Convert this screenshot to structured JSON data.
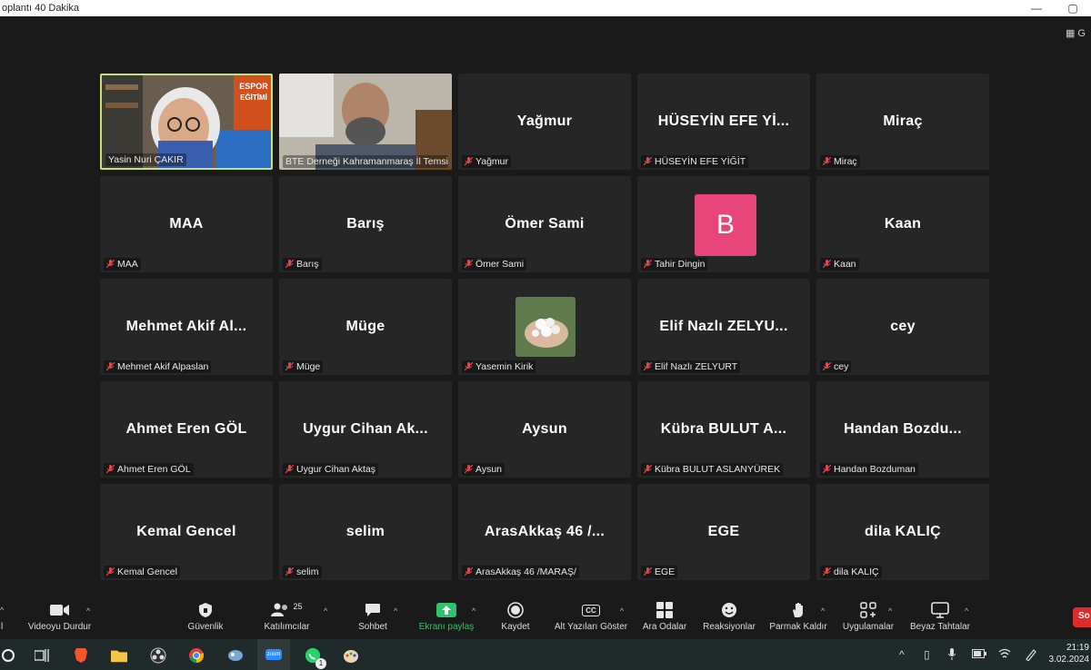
{
  "window": {
    "title": "oplantı 40 Dakika",
    "minimize": "—",
    "maximize": "▢"
  },
  "participants": [
    {
      "display": "",
      "caption": "Yasin Nuri ÇAKIR",
      "video": true
    },
    {
      "display": "",
      "caption": "BTE Derneği Kahramanmaraş İl Temsil...",
      "video": true
    },
    {
      "display": "Yağmur",
      "caption": "Yağmur"
    },
    {
      "display": "HÜSEYİN EFE Yİ...",
      "caption": "HÜSEYİN EFE YİĞİT"
    },
    {
      "display": "Miraç",
      "caption": "Miraç"
    },
    {
      "display": "MAA",
      "caption": "MAA"
    },
    {
      "display": "Barış",
      "caption": "Barış"
    },
    {
      "display": "Ömer Sami",
      "caption": "Ömer Sami"
    },
    {
      "display": "B",
      "caption": "Tahir Dingin",
      "avatar_color": "#e8457a"
    },
    {
      "display": "Kaan",
      "caption": "Kaan"
    },
    {
      "display": "Mehmet Akif Al...",
      "caption": "Mehmet Akif Alpaslan"
    },
    {
      "display": "Müge",
      "caption": "Müge"
    },
    {
      "display": "",
      "caption": "Yasemin Kirik",
      "photo": true
    },
    {
      "display": "Elif Nazlı ZELYU...",
      "caption": "Elif Nazlı ZELYURT"
    },
    {
      "display": "cey",
      "caption": "cey"
    },
    {
      "display": "Ahmet Eren GÖL",
      "caption": "Ahmet Eren GÖL"
    },
    {
      "display": "Uygur Cihan Ak...",
      "caption": "Uygur Cihan Aktaş"
    },
    {
      "display": "Aysun",
      "caption": "Aysun"
    },
    {
      "display": "Kübra BULUT A...",
      "caption": "Kübra BULUT ASLANYÜREK"
    },
    {
      "display": "Handan Bozdu...",
      "caption": "Handan Bozduman"
    },
    {
      "display": "Kemal Gencel",
      "caption": "Kemal Gencel"
    },
    {
      "display": "selim",
      "caption": "selim"
    },
    {
      "display": "ArasAkkaş 46 /...",
      "caption": "ArasAkkaş 46 /MARAŞ/"
    },
    {
      "display": "EGE",
      "caption": "EGE"
    },
    {
      "display": "dila KALIÇ",
      "caption": "dila KALIÇ"
    }
  ],
  "video_overlay": {
    "banner": "ESPOR EĞİTİMİ"
  },
  "toolbar": {
    "audio": "l",
    "video": "Videoyu Durdur",
    "security": "Güvenlik",
    "participants": "Katılımcılar",
    "participant_count": "25",
    "chat": "Sohbet",
    "share": "Ekranı paylaş",
    "record": "Kaydet",
    "captions": "Alt Yazıları Göster",
    "captions_icon": "cc",
    "breakout": "Ara Odalar",
    "reactions": "Reaksiyonlar",
    "raise_hand": "Parmak Kaldır",
    "apps": "Uygulamalar",
    "whiteboard": "Beyaz Tahtalar",
    "end": "So"
  },
  "taskbar": {
    "time": "21:19",
    "date": "3.02.2024",
    "whatsapp_badge": "1",
    "zoom_label": "zoom"
  },
  "colors": {
    "background": "#1a1a1a",
    "tile": "#262626",
    "active_border": "#c6e07a",
    "share_green": "#2fc26b",
    "end_red": "#e02b2b"
  }
}
